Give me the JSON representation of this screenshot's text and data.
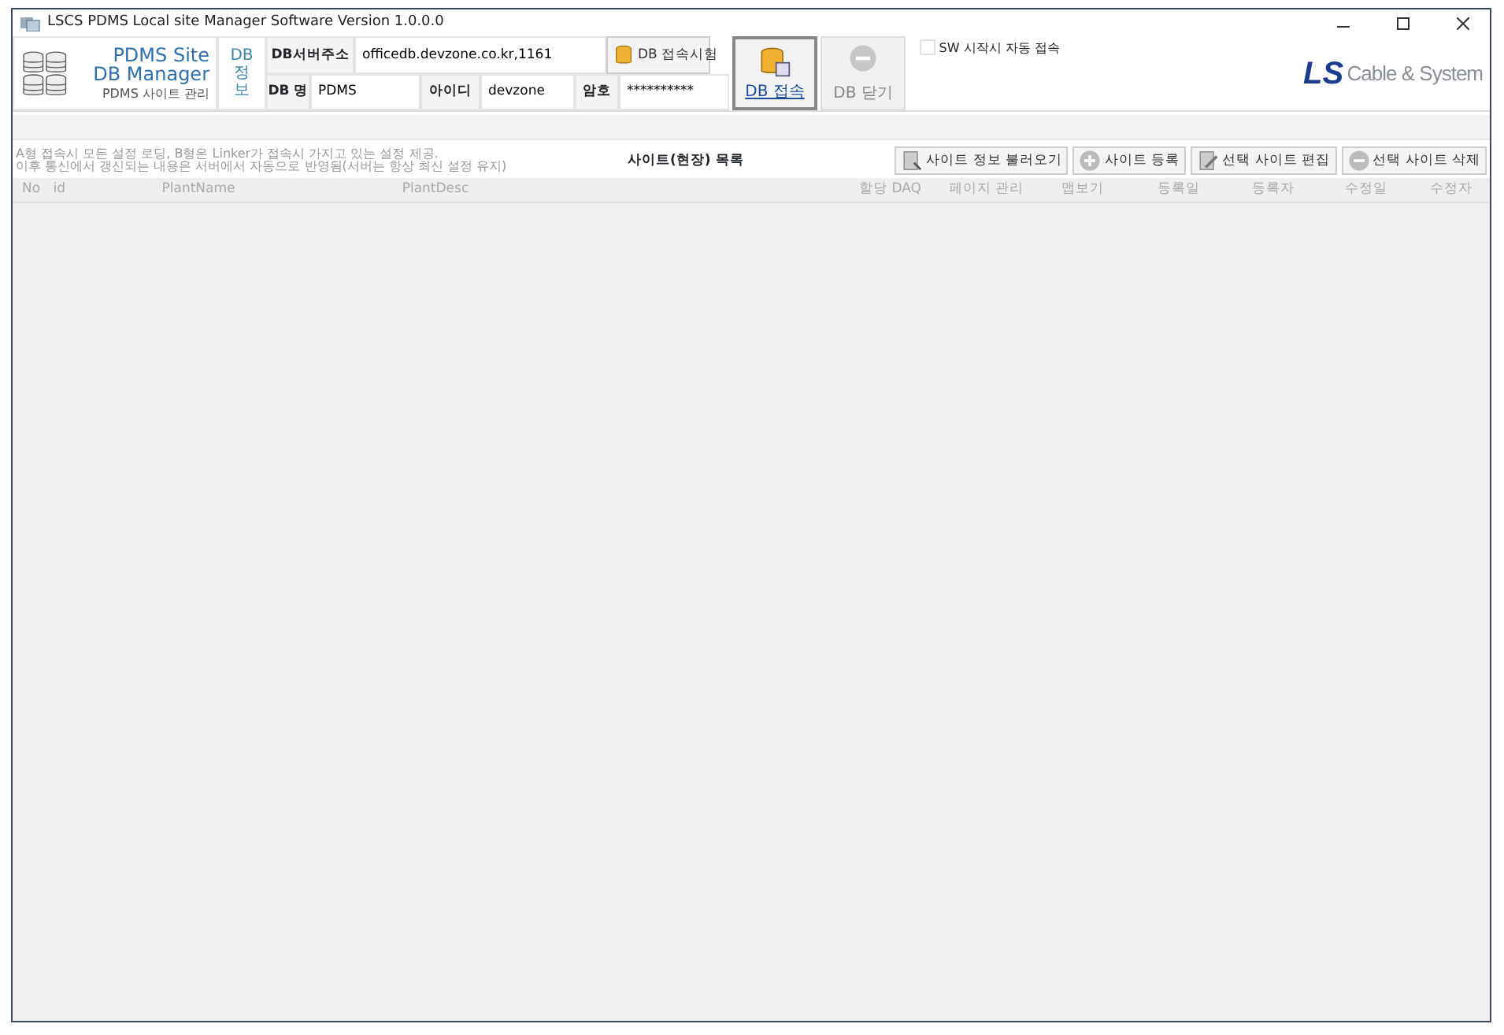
{
  "window": {
    "title": "LSCS PDMS Local site Manager Software Version 1.0.0.0"
  },
  "app_title": {
    "line_1": "PDMS Site",
    "line_2": "DB Manager",
    "subtitle": "PDMS 사이트 관리"
  },
  "db_info_label": "DB 정보",
  "fields": [
    {
      "label": "DB서버주소",
      "value": "officedb.devzone.co.kr,1161"
    },
    {
      "label": "DB 명",
      "value": "PDMS"
    },
    {
      "label": "아이디",
      "value": "devzone"
    },
    {
      "label": "암호",
      "value": "**********"
    }
  ],
  "test_button": "DB 접속시험",
  "connect_buttons": [
    {
      "label": "DB 접속",
      "pressed": true,
      "disabled": false,
      "kind": "connect"
    },
    {
      "label": "DB 닫기",
      "pressed": false,
      "disabled": true,
      "kind": "close"
    }
  ],
  "auto_connect": {
    "label": "SW 시작시 자동 접속",
    "checked": false
  },
  "logo": {
    "mark": "LS",
    "text": "Cable & System"
  },
  "notice": [
    "A형 접속시 모든 설정 로딩, B형은 Linker가 접속시 가지고 있는 설정 제공.",
    "이후 통신에서 갱신되는 내용은 서버에서 자동으로 반영됨(서버는 항상 최신 설정 유지)"
  ],
  "list_title": "사이트(현장) 목록",
  "toolbar": [
    {
      "label": "사이트 정보 불러오기",
      "kind": "load"
    },
    {
      "label": "사이트 등록",
      "kind": "add"
    },
    {
      "label": "선택 사이트 편집",
      "kind": "edit"
    },
    {
      "label": "선택 사이트 삭제",
      "kind": "delete"
    }
  ],
  "table": {
    "columns": [
      "No",
      "id",
      "PlantName",
      "PlantDesc",
      "할당 DAQ",
      "페이지 관리",
      "맵보기",
      "등록일",
      "등록자",
      "수정일",
      "수정자"
    ]
  }
}
